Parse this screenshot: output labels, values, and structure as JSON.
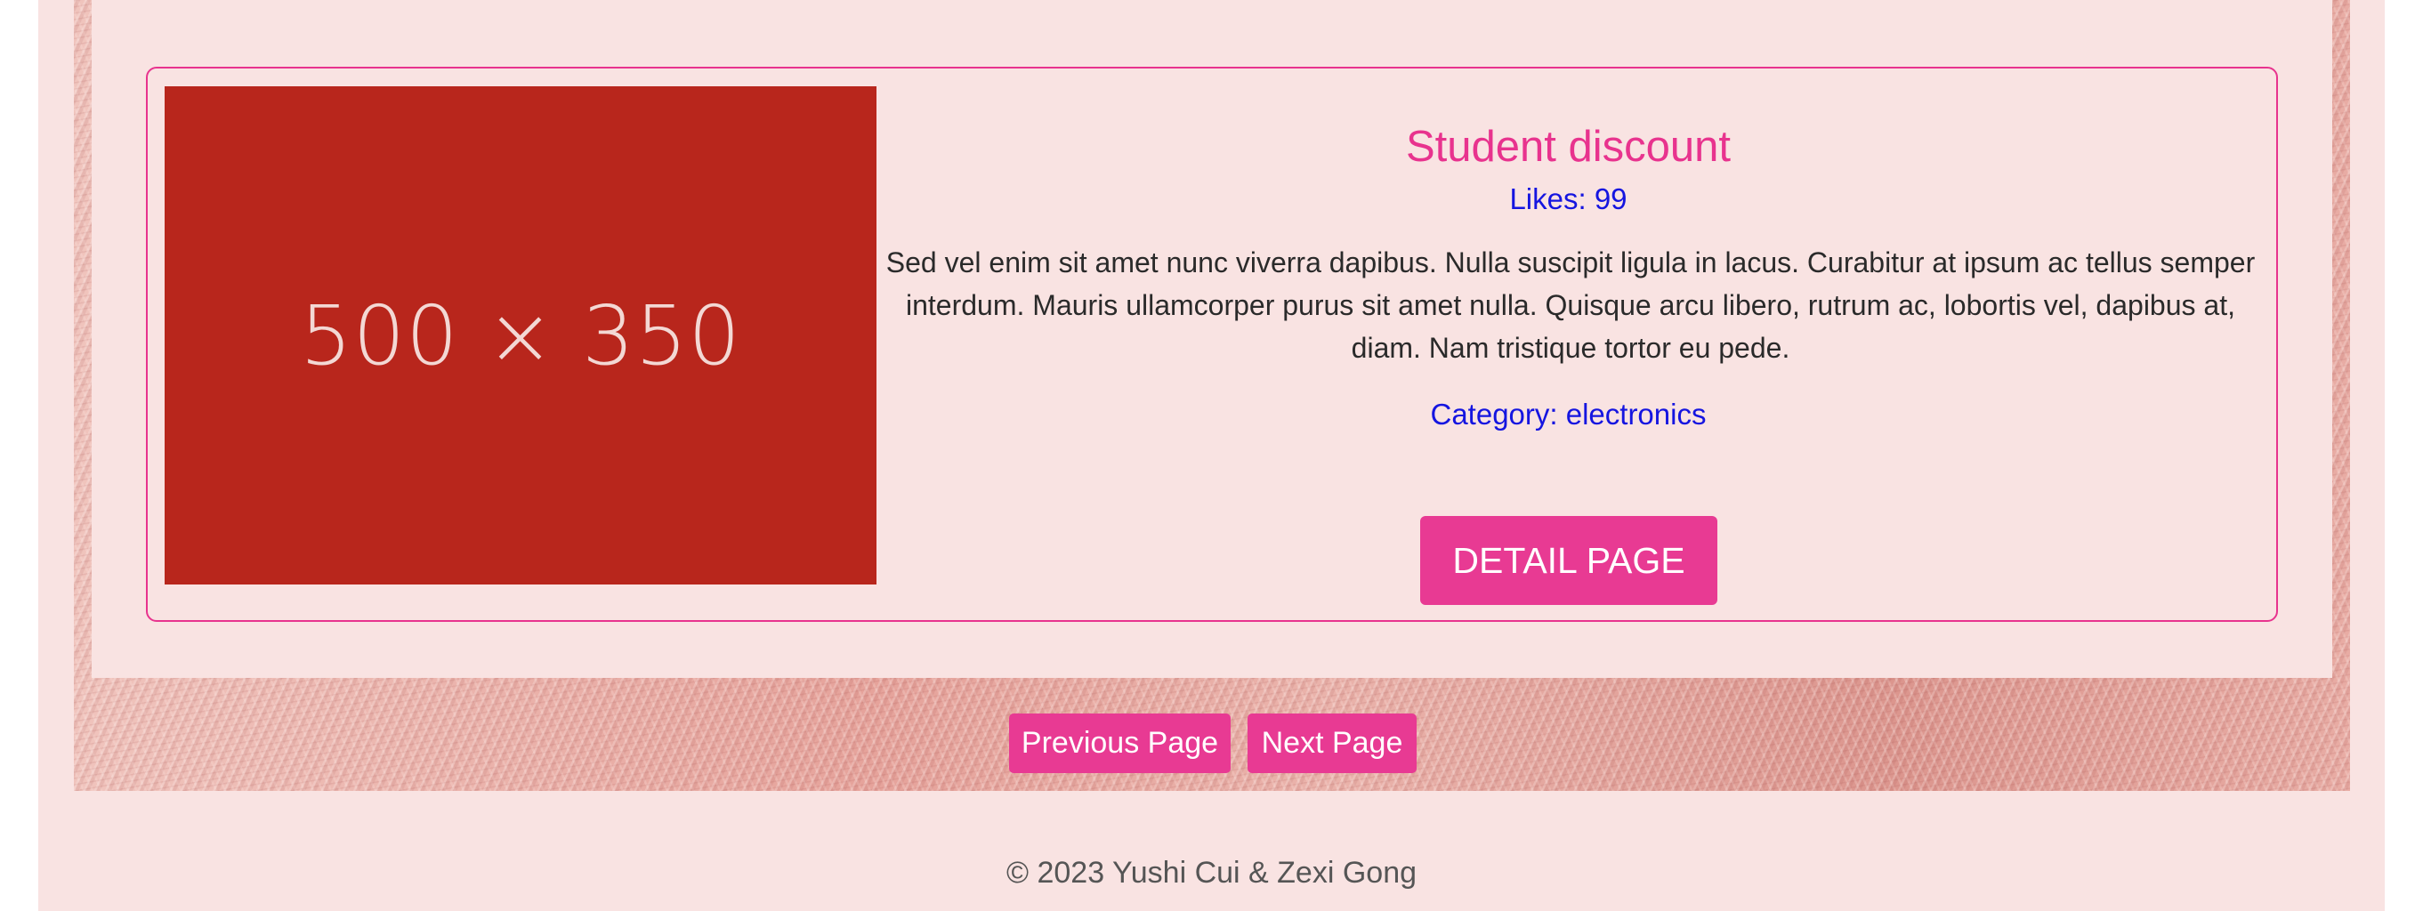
{
  "product": {
    "image_placeholder": "500 × 350",
    "title": "Student discount",
    "likes": "Likes: 99",
    "description": "Sed vel enim sit amet nunc viverra dapibus. Nulla suscipit ligula in lacus. Curabitur at ipsum ac tellus semper interdum. Mauris ullamcorper purus sit amet nulla. Quisque arcu libero, rutrum ac, lobortis vel, dapibus at, diam. Nam tristique tortor eu pede.",
    "category": "Category: electronics",
    "detail_label": "DETAIL PAGE"
  },
  "pagination": {
    "previous_label": "Previous Page",
    "next_label": "Next Page"
  },
  "footer": {
    "copyright": "© 2023 Yushi Cui & Zexi Gong"
  },
  "colors": {
    "accent": "#e8338e",
    "button": "#e83a93",
    "link": "#1515e0",
    "image_placeholder": "#b8261c",
    "panel_background": "#f9e3e2"
  }
}
